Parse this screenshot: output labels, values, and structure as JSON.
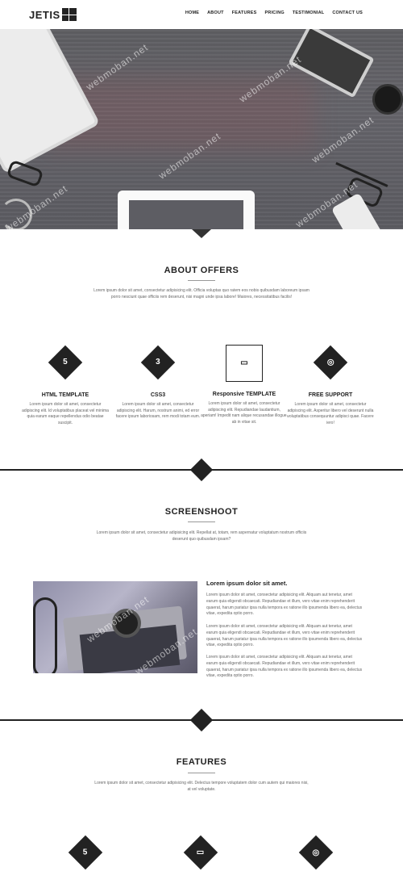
{
  "brand": {
    "logo_text": "JETIS"
  },
  "nav": {
    "items": [
      {
        "label": "HOME"
      },
      {
        "label": "ABOUT"
      },
      {
        "label": "FEATURES"
      },
      {
        "label": "PRICING"
      },
      {
        "label": "TESTIMONIAL"
      },
      {
        "label": "CONTACT US"
      }
    ]
  },
  "hero": {
    "watermark": "webmoban.net",
    "slider_count": 5,
    "slider_active_index": 2
  },
  "about": {
    "title": "ABOUT OFFERS",
    "description": "Lorem ipsum dolor sit amet, consectetur adipisicing elit. Officia voluptas quo ratem eos nobis quibusdam laboreum ipsam porro nesciunt quae officiis rem deserunt, nisi magni unde ipsa labore! Maiores, necessitatibus facilis!",
    "offers": [
      {
        "icon": "html5-icon",
        "glyph": "5",
        "title": "HTML TEMPLATE",
        "text": "Lorem ipsum dolor sit amet, consectetur adipiscing elit. Id voluptatibus placeat vel minima quia earum eaque repellendus odio beatae suscipit."
      },
      {
        "icon": "css3-icon",
        "glyph": "3",
        "title": "CSS3",
        "text": "Lorem ipsum dolor sit amet, consectetur adipiscing elit. Harum, nostrum animi, ed error facere ipsum laboriosam, rem modi totam eum."
      },
      {
        "icon": "responsive-icon",
        "glyph": "▭",
        "title": "Responsive TEMPLATE",
        "text": "Lorem ipsum dolor sit amet, consectetur adipiscing elit. Repudiandae laudantium, aperiam! Impedit nam alique recusandae illogue, ab in vitae sit."
      },
      {
        "icon": "support-icon",
        "glyph": "◎",
        "title": "FREE SUPPORT",
        "text": "Lorem ipsum dolor sit amet, consectetur adipiscing elit. Asperitur libero vel deserunt nulla voluptatibus consequuntur adipisci quae. Facere iero!"
      }
    ]
  },
  "screenshoot": {
    "title": "SCREENSHOOT",
    "description": "Lorem ipsum dolor sit amet, consectetur adipisicing elit. Repellat at, totam, rem aspernatur voluptatum nostrum officiis deserunt quo quibusdam ipsam?",
    "heading": "Lorem ipsum dolor sit amet.",
    "paragraphs": [
      "Lorem ipsum dolor sit amet, consectetur adipisicing elit. Aliquam aut tenetur, amet earum quia eligendi obcaecati. Repudiandae et illum, vero vitae enim reprehenderit quaerat, harum pariatur ipsa nulla tempora ex ratione illo ipsumenda libero ea, delectus vitae, expedita optio porro.",
      "Lorem ipsum dolor sit amet, consectetur adipisicing elit. Aliquam aut tenetur, amet earum quia eligendi obcaecati. Repudiandae et illum, vero vitae enim reprehenderit quaerat, harum pariatur ipsa nulla tempora ex ratione illo ipsumenda libero ea, delectus vitae, expedita optio porro.",
      "Lorem ipsum dolor sit amet, consectetur adipisicing elit. Aliquam aut tenetur, amet earum quia eligendi obcaecati. Repudiandae et illum, vero vitae enim reprehenderit quaerat, harum pariatur ipsa nulla tempora ex ratione illo ipsumenda libero ea, delectus vitae, expedita optio porro."
    ]
  },
  "features": {
    "title": "FEATURES",
    "description": "Lorem ipsum dolor sit amet, consectetur adipisicing elit. Delectus tempore voluptatem dolor cum autem qui maiores nisi, at vel voluptate.",
    "items": [
      {
        "icon": "html5-icon",
        "glyph": "5"
      },
      {
        "icon": "responsive-icon",
        "glyph": "▭"
      },
      {
        "icon": "support-icon",
        "glyph": "◎"
      }
    ]
  },
  "colors": {
    "accent": "#222222",
    "text_muted": "#666666"
  }
}
